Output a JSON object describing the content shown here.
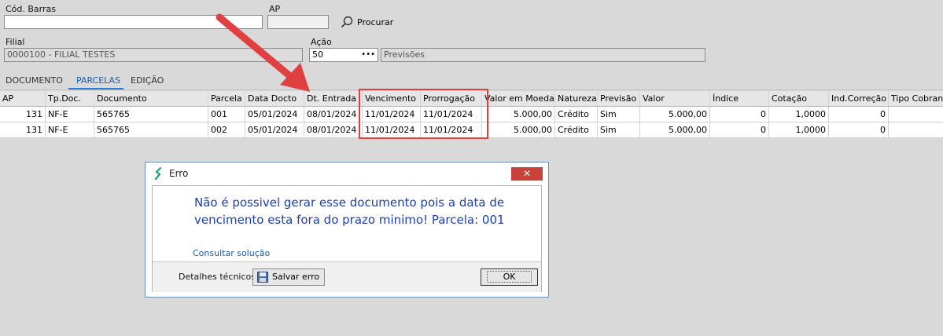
{
  "form": {
    "cod_barras_label": "Cód. Barras",
    "ap_label": "AP",
    "procurar_label": "Procurar",
    "filial_label": "Filial",
    "filial_value": "0000100 - FILIAL TESTES",
    "acao_label": "Ação",
    "acao_value": "50",
    "acao_lookup": "•••",
    "acao_desc": "Previsões"
  },
  "tabs": [
    "DOCUMENTO",
    "PARCELAS",
    "EDIÇÃO"
  ],
  "table": {
    "headers": [
      "AP",
      "Tp.Doc.",
      "Documento",
      "Parcela",
      "Data Docto",
      "Dt. Entrada",
      "Vencimento",
      "Prorrogação",
      "Valor em Moeda",
      "Natureza",
      "Previsão",
      "Valor",
      "Índice",
      "Cotação",
      "Ind.Correção",
      "Tipo Cobran"
    ],
    "rows": [
      [
        "131",
        "NF-E",
        "565765",
        "001",
        "05/01/2024",
        "08/01/2024",
        "11/01/2024",
        "11/01/2024",
        "5.000,00",
        "Crédito",
        "Sim",
        "5.000,00",
        "0",
        "1,0000",
        "0",
        ""
      ],
      [
        "131",
        "NF-E",
        "565765",
        "002",
        "05/01/2024",
        "08/01/2024",
        "11/01/2024",
        "11/01/2024",
        "5.000,00",
        "Crédito",
        "Sim",
        "5.000,00",
        "0",
        "1,0000",
        "0",
        ""
      ]
    ]
  },
  "dialog": {
    "title": "Erro",
    "close": "✕",
    "message_line1": "Não é possivel gerar esse documento pois a data de",
    "message_line2": "vencimento esta fora do prazo minimo! Parcela: 001",
    "link": "Consultar solução",
    "details_label": "Detalhes técnicos",
    "save_button": "Salvar erro",
    "ok_button": "OK"
  },
  "colors": {
    "annotation": "#e04040",
    "accent": "#2b7ad6",
    "message": "#1d3fb0"
  }
}
